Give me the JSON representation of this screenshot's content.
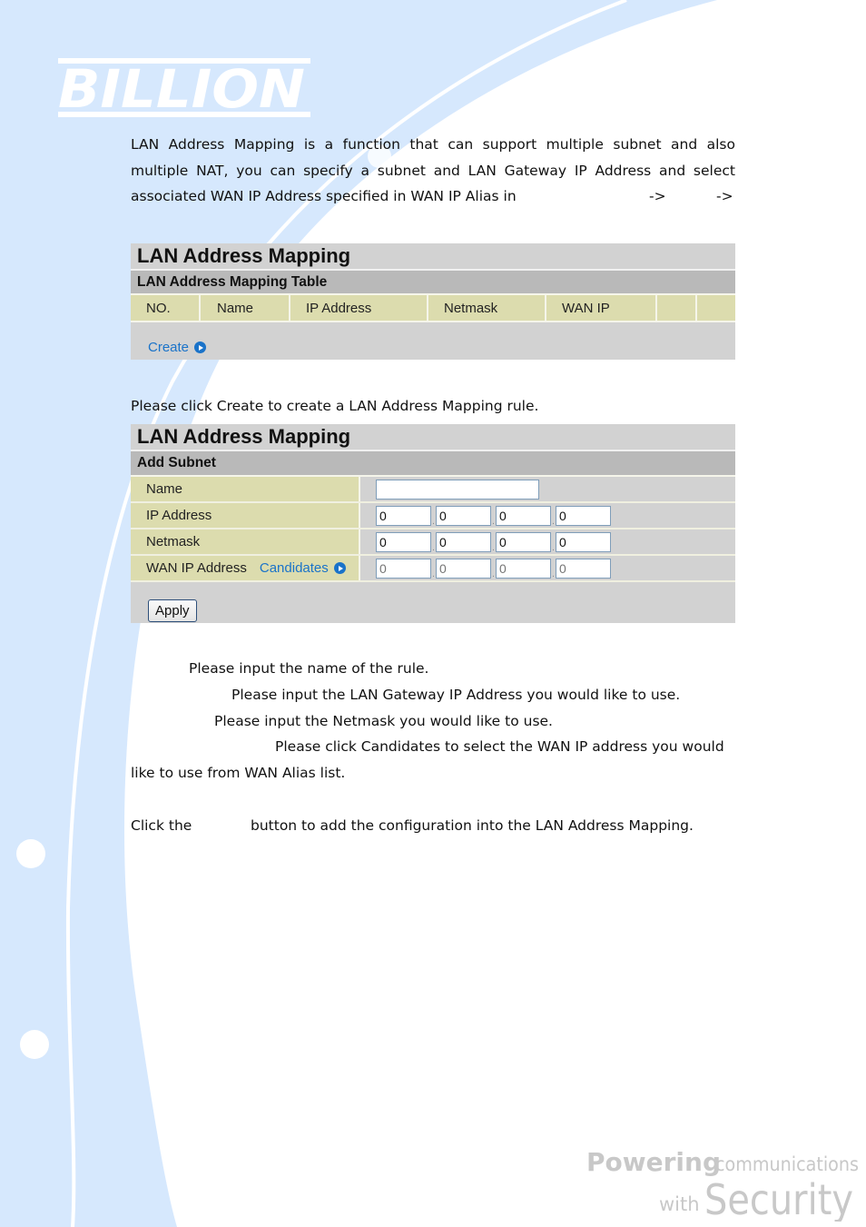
{
  "brand": {
    "logo_text": "BILLION",
    "tagline_line1_bold": "Powering",
    "tagline_line1_rest": "communications",
    "tagline_line2_small": "with",
    "tagline_line2_big": "Security",
    "colors": {
      "background_swoosh": "#d6e8fd",
      "panel_header": "#d2d2d2",
      "panel_subheader": "#b9b9b9",
      "label_cell": "#dcdcae",
      "link": "#1a73c9"
    }
  },
  "intro": {
    "lines": [
      "LAN Address Mapping is a function that can support multiple subnet and also",
      "multiple NAT, you can specify a subnet and LAN Gateway IP Address and select"
    ],
    "last_line": "associated WAN IP Address specified in WAN IP Alias in",
    "arrow1": "->",
    "arrow2": "->"
  },
  "table_panel": {
    "title": "LAN Address Mapping",
    "subtitle": "LAN Address Mapping Table",
    "columns": [
      "NO.",
      "Name",
      "IP Address",
      "Netmask",
      "WAN IP",
      "",
      ""
    ],
    "create_link": "Create"
  },
  "between_text": "Please click Create to create a LAN Address Mapping rule.",
  "form_panel": {
    "title": "LAN Address Mapping",
    "subtitle": "Add Subnet",
    "rows": {
      "name": {
        "label": "Name",
        "value": ""
      },
      "ip": {
        "label": "IP Address",
        "octets": [
          "0",
          "0",
          "0",
          "0"
        ]
      },
      "netmask": {
        "label": "Netmask",
        "octets": [
          "0",
          "0",
          "0",
          "0"
        ]
      },
      "wan": {
        "label": "WAN IP Address",
        "link": "Candidates",
        "placeholders": [
          "0",
          "0",
          "0",
          "0"
        ]
      }
    },
    "apply_label": "Apply"
  },
  "descriptions": {
    "name": "Please input the name of the rule.",
    "ip": "Please input the LAN Gateway IP Address you would like to use.",
    "netmask": "Please input the Netmask you would like to use.",
    "wan_line1": "Please click Candidates to select the WAN IP address you would",
    "wan_line2": "like to use from WAN Alias list.",
    "apply_pre": "Click the",
    "apply_post": "button to add the configuration into the LAN Address Mapping."
  }
}
